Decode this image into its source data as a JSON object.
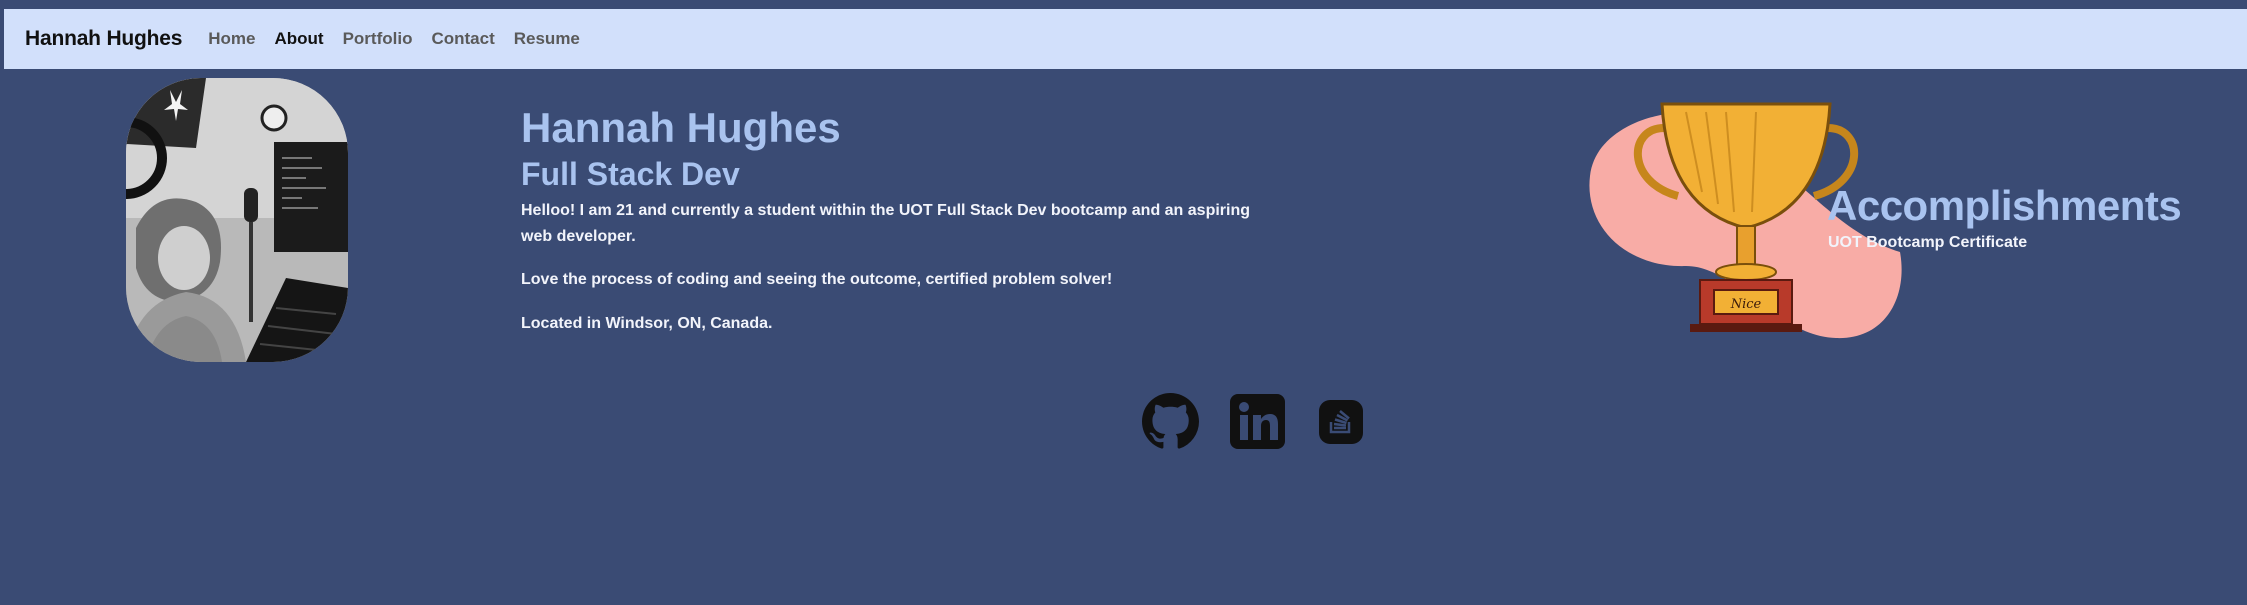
{
  "navbar": {
    "brand": "Hannah Hughes",
    "links": [
      {
        "label": "Home",
        "active": false
      },
      {
        "label": "About",
        "active": true
      },
      {
        "label": "Portfolio",
        "active": false
      },
      {
        "label": "Contact",
        "active": false
      },
      {
        "label": "Resume",
        "active": false
      }
    ]
  },
  "about": {
    "name": "Hannah Hughes",
    "title": "Full Stack Dev",
    "paragraphs": [
      "Helloo! I am 21 and currently a student within the UOT Full Stack Dev bootcamp and an aspiring web developer.",
      "Love the process of coding and seeing the outcome, certified problem solver!",
      "Located in Windsor, ON, Canada."
    ]
  },
  "accomplishments": {
    "title": "Accomplishments",
    "items": [
      "UOT Bootcamp Certificate"
    ],
    "trophy_plaque_text": "Nice"
  },
  "social": [
    {
      "name": "github-icon"
    },
    {
      "name": "linkedin-icon"
    },
    {
      "name": "stackoverflow-icon"
    }
  ],
  "colors": {
    "background": "#3a4b74",
    "navbar": "#d2e0fb",
    "heading": "#a9c3ef",
    "blob": "#f8aca6",
    "trophy": "#f2b035"
  }
}
